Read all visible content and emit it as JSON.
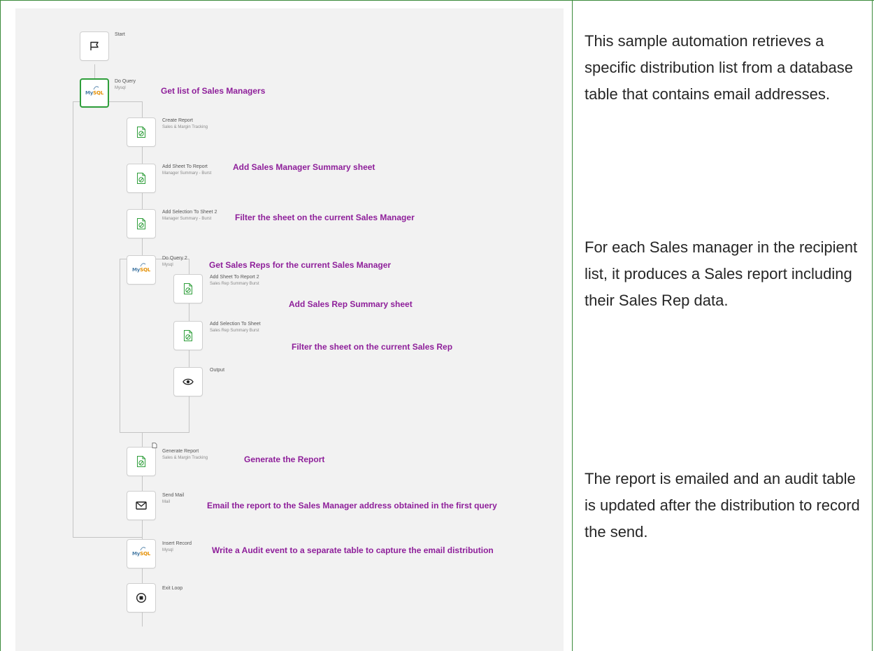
{
  "diagram": {
    "nodes": {
      "start": {
        "title": "Start",
        "icon": "flag-icon"
      },
      "do_query": {
        "title": "Do Query",
        "subtitle": "Mysql",
        "icon": "mysql-icon"
      },
      "create_report": {
        "title": "Create Report",
        "subtitle": "Sales & Margin Tracking",
        "icon": "report-icon"
      },
      "add_sheet": {
        "title": "Add Sheet To Report",
        "subtitle": "Manager Summary - Burst",
        "icon": "report-icon"
      },
      "add_selection_2": {
        "title": "Add Selection To Sheet 2",
        "subtitle": "Manager Summary - Burst",
        "icon": "report-icon"
      },
      "do_query_2": {
        "title": "Do Query 2",
        "subtitle": "Mysql",
        "icon": "mysql-icon"
      },
      "add_sheet_2": {
        "title": "Add Sheet To Report 2",
        "subtitle": "Sales Rep Summary Burst",
        "icon": "report-icon"
      },
      "add_selection": {
        "title": "Add Selection To Sheet",
        "subtitle": "Sales Rep Summary Burst",
        "icon": "report-icon"
      },
      "output": {
        "title": "Output",
        "icon": "eye-icon"
      },
      "generate_report": {
        "title": "Generate Report",
        "subtitle": "Sales & Margin Tracking",
        "icon": "report-icon"
      },
      "send_mail": {
        "title": "Send Mail",
        "subtitle": "Mail",
        "icon": "mail-icon"
      },
      "insert_record": {
        "title": "Insert Record",
        "subtitle": "Mysql",
        "icon": "mysql-icon"
      },
      "exit_loop": {
        "title": "Exit Loop",
        "icon": "stop-icon"
      }
    },
    "mysql_logo": {
      "my": "My",
      "sql": "SQL"
    },
    "annotations": {
      "do_query": "Get list of Sales Managers",
      "add_sheet": "Add Sales Manager Summary sheet",
      "add_selection_2": "Filter the sheet on the current Sales Manager",
      "do_query_2": "Get Sales Reps for the current Sales Manager",
      "add_sheet_2": "Add Sales Rep  Summary sheet",
      "add_selection": "Filter the sheet on the current Sales Rep",
      "generate_report": "Generate the Report",
      "send_mail": "Email the report to the Sales Manager address obtained in the first query",
      "insert_record": "Write a Audit event to a separate table to capture the email distribution"
    },
    "colors": {
      "annotation": "#8e1f9a",
      "selected_border": "#2e9e3a",
      "frame": "#3a8a3a"
    }
  },
  "description": {
    "paragraph_1": "This sample automation retrieves a specific distribution list from a database table that contains email addresses.",
    "paragraph_2": "For each Sales manager in the recipient list, it produces a Sales report including their Sales Rep data.",
    "paragraph_3": "The report is emailed and an audit table is updated after the distribution to record the send."
  }
}
